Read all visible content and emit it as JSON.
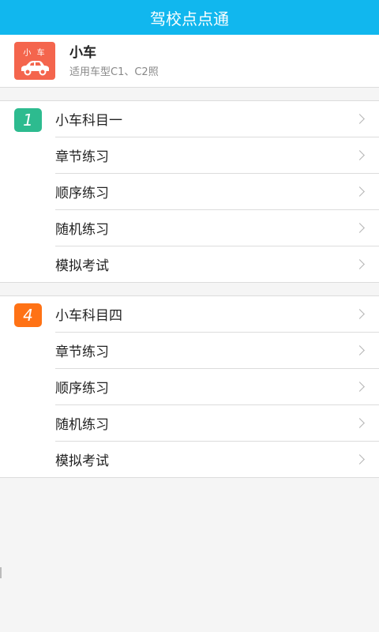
{
  "app": {
    "title": "驾校点点通"
  },
  "vehicle": {
    "badge_label": "小 车",
    "name": "小车",
    "description": "适用车型C1、C2照",
    "badge_color": "#f4654d"
  },
  "sections": [
    {
      "badge": "1",
      "badge_color": "#2dbb8f",
      "items": [
        {
          "label": "小车科目一"
        },
        {
          "label": "章节练习"
        },
        {
          "label": "顺序练习"
        },
        {
          "label": "随机练习"
        },
        {
          "label": "模拟考试"
        }
      ]
    },
    {
      "badge": "4",
      "badge_color": "#ff7215",
      "items": [
        {
          "label": "小车科目四"
        },
        {
          "label": "章节练习"
        },
        {
          "label": "顺序练习"
        },
        {
          "label": "随机练习"
        },
        {
          "label": "模拟考试"
        }
      ]
    }
  ],
  "colors": {
    "accent": "#11b7ee"
  }
}
